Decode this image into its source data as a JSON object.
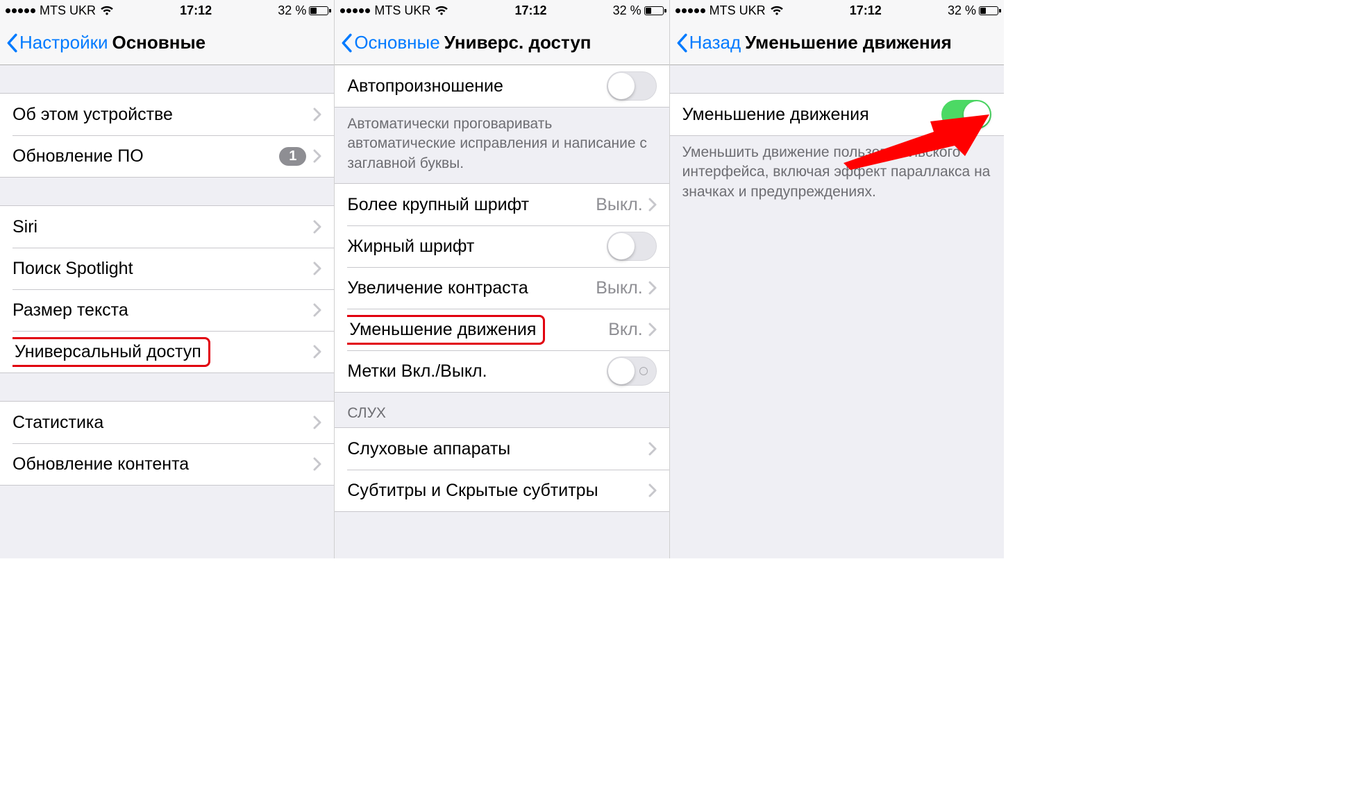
{
  "status": {
    "carrier": "MTS UKR",
    "time": "17:12",
    "battery_text": "32 %"
  },
  "panel1": {
    "back": "Настройки",
    "title": "Основные",
    "g1": {
      "about": "Об этом устройстве",
      "update": "Обновление ПО",
      "update_badge": "1"
    },
    "g2": {
      "siri": "Siri",
      "spotlight": "Поиск Spotlight",
      "textsize": "Размер текста",
      "accessibility": "Универсальный доступ"
    },
    "g3": {
      "stats": "Статистика",
      "refresh": "Обновление контента"
    }
  },
  "panel2": {
    "back": "Основные",
    "title": "Универс. доступ",
    "auto_speech": "Автопроизношение",
    "auto_speech_footer": "Автоматически проговаривать автоматические исправления и написание с заглавной буквы.",
    "larger_font": "Более крупный шрифт",
    "larger_font_val": "Выкл.",
    "bold": "Жирный шрифт",
    "contrast": "Увеличение контраста",
    "contrast_val": "Выкл.",
    "reduce_motion": "Уменьшение движения",
    "reduce_motion_val": "Вкл.",
    "onoff_labels": "Метки Вкл./Выкл.",
    "hearing_header": "СЛУХ",
    "hearing_aid": "Слуховые аппараты",
    "subtitles": "Субтитры и Скрытые субтитры"
  },
  "panel3": {
    "back": "Назад",
    "title": "Уменьшение движения",
    "row_label": "Уменьшение движения",
    "footer": "Уменьшить движение пользовательского интерфейса, включая эффект параллакса на значках и предупреждениях."
  }
}
